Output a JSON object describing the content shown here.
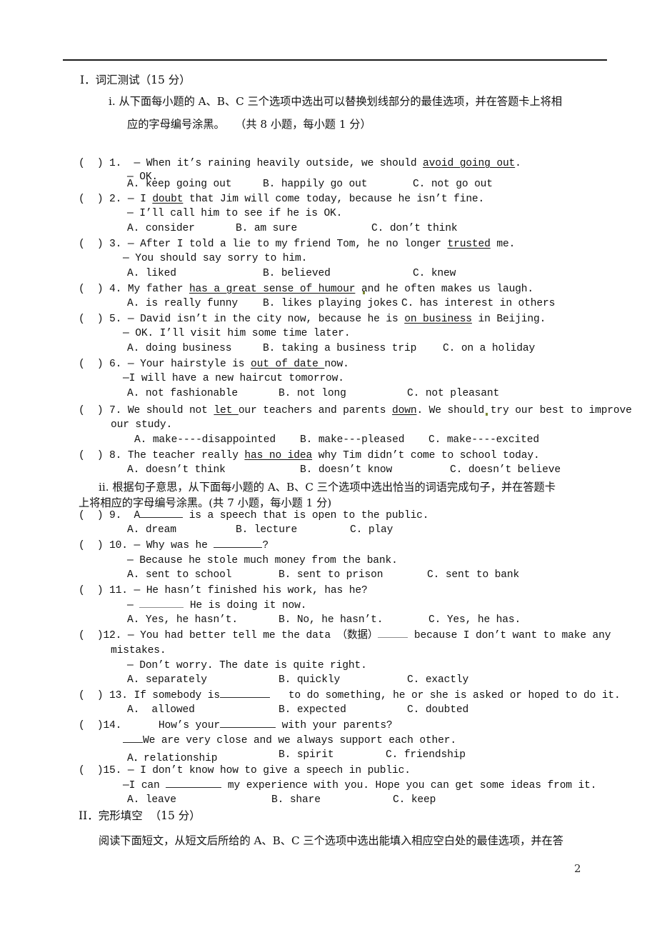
{
  "document": {
    "page_number": "2",
    "horizontal_rule": true
  },
  "sections": [
    {
      "id": "section-1",
      "heading": "I．词汇测试（15 分）",
      "subsections": [
        {
          "id": "subsection-i",
          "instruction_line1": "i. 从下面每小题的 A、B、C 三个选项中选出可以替换划线部分的最佳选项，并在答题卡上将相",
          "instruction_line2": "应的字母编号涂黑。   （共 8 小题，每小题 1 分）"
        }
      ]
    }
  ],
  "questions": [
    {
      "number": "1.",
      "bracket": "（  ）",
      "stem_pre": "1.  — When it’s raining heavily outside, we should ",
      "stem_underlined": "avoid going out",
      "stem_post": ".",
      "reply": "— OK.",
      "options": {
        "a": "A. keep going out",
        "b": "B. happily go out",
        "c": "C. not go out"
      }
    },
    {
      "number": "2.",
      "stem_pre": "2. — I ",
      "stem_underlined": "doubt",
      "stem_post": " that Jim will come today, because he isn’t fine.",
      "reply": "— I’ll call him to see if he is OK.",
      "options": {
        "a": "A. consider",
        "b": "B. am sure",
        "c": "C. don’t think"
      }
    },
    {
      "number": "3.",
      "stem_pre": "3. — After I told a lie to my friend Tom, he no longer ",
      "stem_underlined": "trusted",
      "stem_post": " me.",
      "reply": "— You should say sorry to him.",
      "options": {
        "a": "A. liked",
        "b": "B. believed",
        "c": "C. knew"
      }
    },
    {
      "number": "4.",
      "stem_pre": "4. My father ",
      "stem_underlined": "has a great sense of humour",
      "stem_post": " and he often makes us laugh.",
      "options": {
        "a": "A. is really funny",
        "b": "B. likes playing jokes",
        "c": "C. has interest in others"
      }
    },
    {
      "number": "5.",
      "stem_pre": "5. — David isn’t in the city now, because he is ",
      "stem_underlined": "on business",
      "stem_post": " in Beijing.",
      "reply": "— OK. I’ll visit him some time later.",
      "options": {
        "a": "A. doing business",
        "b": "B. taking a business trip",
        "c": "C. on a holiday"
      }
    },
    {
      "number": "6.",
      "stem_pre": "6. — Your hairstyle is ",
      "stem_underlined": "out of date ",
      "stem_post": "now.",
      "reply": "—I will have a new haircut tomorrow.",
      "options": {
        "a": "A. not fashionable",
        "b": "B. not long",
        "c": "C. not pleasant"
      }
    },
    {
      "number": "7.",
      "stem_pre": "7. We should not ",
      "stem_underlined": "let ",
      "stem_mid": "our teachers and parents ",
      "stem_underlined2": "down",
      "stem_post": ". We should try our best to improve",
      "stem_cont": "our study.",
      "options": {
        "a": "A. make----disappointed",
        "b": "B. make---pleased",
        "c": "C. make----excited"
      }
    },
    {
      "number": "8.",
      "stem_pre": "8. The teacher really ",
      "stem_underlined": "has no idea",
      "stem_post": " why Tim didn’t come to school today.",
      "options": {
        "a": "A. doesn’t think",
        "b": "B. doesn’t know",
        "c": "C. doesn’t believe"
      }
    },
    {
      "number": "9.",
      "stem_pre": "9.  A",
      "stem_post": " is a speech that is open to the public.",
      "options": {
        "a": "A. dream",
        "b": "B. lecture",
        "c": "C. play"
      }
    },
    {
      "number": "10.",
      "stem_pre": "10. — Why was he ",
      "stem_post": "?",
      "reply": "— Because he stole much money from the bank.",
      "options": {
        "a": "A. sent to school",
        "b": "B. sent to prison",
        "c": "C. sent to bank"
      }
    },
    {
      "number": "11.",
      "stem_pre": "11. — He hasn’t finished his work, has he?",
      "reply_pre": "— ",
      "reply_post": " He is doing it now.",
      "options": {
        "a": "A. Yes, he hasn’t.",
        "b": "B. No, he hasn’t.",
        "c": "C. Yes, he has."
      }
    },
    {
      "number": "12.",
      "stem_pre": "12. — You had better tell me the data （数据）",
      "stem_post": " because I don’t want to make any",
      "stem_cont": "mistakes.",
      "reply": "— Don’t worry. The date is quite right.",
      "options": {
        "a": "A. separately",
        "b": "B. quickly",
        "c": "C. exactly"
      }
    },
    {
      "number": "13.",
      "stem_pre": "13. If somebody is",
      "stem_post": "   to do something, he or she is asked or hoped to do it.",
      "options": {
        "a": "A.  allowed",
        "b": "B. expected",
        "c": "C. doubted"
      }
    },
    {
      "number": "14.",
      "stem_pre": "14.      How’s your",
      "stem_post": " with your parents?",
      "reply_post": "We are very close and we always support each other.",
      "options": {
        "a": "A．relationship",
        "b": "B. spirit",
        "c": "C. friendship"
      }
    },
    {
      "number": "15.",
      "stem_pre": "15. — I don’t know how to give a speech in public.",
      "reply_pre": "—I can ",
      "reply_post": " my experience with you. Hope you can get some ideas from it.",
      "options": {
        "a": "A. leave",
        "b": "B. share",
        "c": "C. keep"
      }
    }
  ],
  "subsection_ii": {
    "instruction_line1": "ii. 根据句子意思，从下面每小题的 A、B、C 三个选项中选出恰当的词语完成句子，并在答题卡",
    "instruction_line2": "上将相应的字母编号涂黑。(共 7 小题，每小题 1 分)"
  },
  "section_2": {
    "heading": "II．完形填空  （15 分）",
    "instruction": "阅读下面短文，从短文后所给的 A、B、C 三个选项中选出能填入相应空白处的最佳选项，并在答"
  },
  "bracket_mark": "（  ）"
}
